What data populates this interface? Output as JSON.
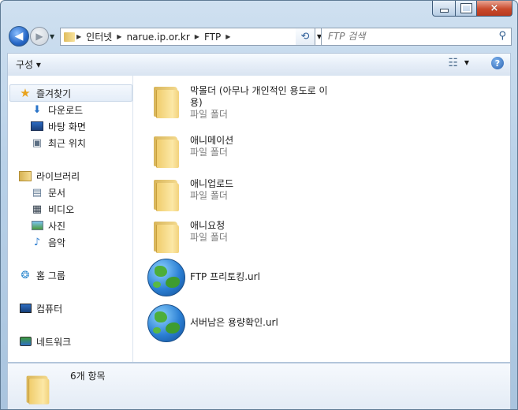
{
  "window": {
    "controls": {
      "minimize": "minimize",
      "maximize": "maximize",
      "close": "×"
    }
  },
  "address": {
    "crumbs": [
      "인터넷",
      "narue.ip.or.kr",
      "FTP"
    ],
    "search_placeholder": "FTP 검색"
  },
  "toolbar": {
    "organize_label": "구성 ▾",
    "help_label": "?"
  },
  "nav": {
    "favorites": "즐겨찾기",
    "downloads": "다운로드",
    "desktop": "바탕 화면",
    "recent": "최근 위치",
    "libraries": "라이브러리",
    "documents": "문서",
    "videos": "비디오",
    "pictures": "사진",
    "music": "음악",
    "homegroup": "홈 그룹",
    "computer": "컴퓨터",
    "network": "네트워크"
  },
  "items": [
    {
      "name": "막몰더 (아무나 개인적인 용도로 이용)",
      "type": "파일 폴더",
      "icon": "folder-icon"
    },
    {
      "name": "애니메이션",
      "type": "파일 폴더",
      "icon": "folder-icon"
    },
    {
      "name": "애니업로드",
      "type": "파일 폴더",
      "icon": "folder-icon"
    },
    {
      "name": "애니요청",
      "type": "파일 폴더",
      "icon": "folder-icon"
    },
    {
      "name": "FTP 프리토킹.url",
      "type": "",
      "icon": "globe-icon"
    },
    {
      "name": "서버남은 용량확인.url",
      "type": "",
      "icon": "globe-icon"
    }
  ],
  "status": {
    "count": "6개 항목"
  }
}
